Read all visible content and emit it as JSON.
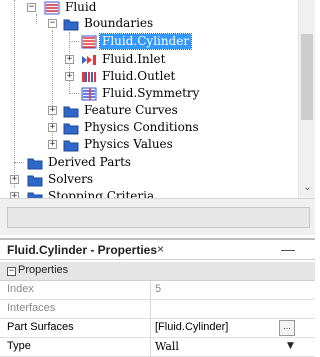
{
  "tree": {
    "items": [
      {
        "label": "Fluid",
        "selected": false
      },
      {
        "label": "Boundaries",
        "selected": false
      },
      {
        "label": "Fluid.Cylinder",
        "selected": true
      },
      {
        "label": "Fluid.Inlet",
        "selected": false
      },
      {
        "label": "Fluid.Outlet",
        "selected": false
      },
      {
        "label": "Fluid.Symmetry",
        "selected": false
      },
      {
        "label": "Feature Curves",
        "selected": false
      },
      {
        "label": "Physics Conditions",
        "selected": false
      },
      {
        "label": "Physics Values",
        "selected": false
      },
      {
        "label": "Derived Parts",
        "selected": false
      },
      {
        "label": "Solvers",
        "selected": false
      },
      {
        "label": "Stopping Criteria",
        "selected": false
      }
    ],
    "expand_glyphs": {
      "expanded": "−",
      "collapsed": "+"
    }
  },
  "scrollbar": {
    "down_arrow": "⌄"
  },
  "properties": {
    "title": "Fluid.Cylinder - Properties",
    "close_glyph": "×",
    "minimize_glyph": "—",
    "category": {
      "label": "Properties",
      "collapse_glyph": "−"
    },
    "rows": [
      {
        "name": "Index",
        "value": "5"
      },
      {
        "name": "Interfaces",
        "value": ""
      },
      {
        "name": "Part Surfaces",
        "value": "[Fluid.Cylinder]",
        "button": "..."
      },
      {
        "name": "Type",
        "value": "Wall",
        "dropdown": "▼"
      }
    ]
  },
  "colors": {
    "selection": "#3399ff",
    "folder": "#2f66c9",
    "boundary_wall": "#e23a3a",
    "boundary_inlet": "#2f66c9"
  },
  "icons": {
    "region": "region-icon",
    "folder": "folder-icon",
    "wall": "wall-boundary-icon",
    "inlet": "inlet-boundary-icon",
    "outlet": "outlet-boundary-icon",
    "symmetry": "symmetry-boundary-icon"
  }
}
